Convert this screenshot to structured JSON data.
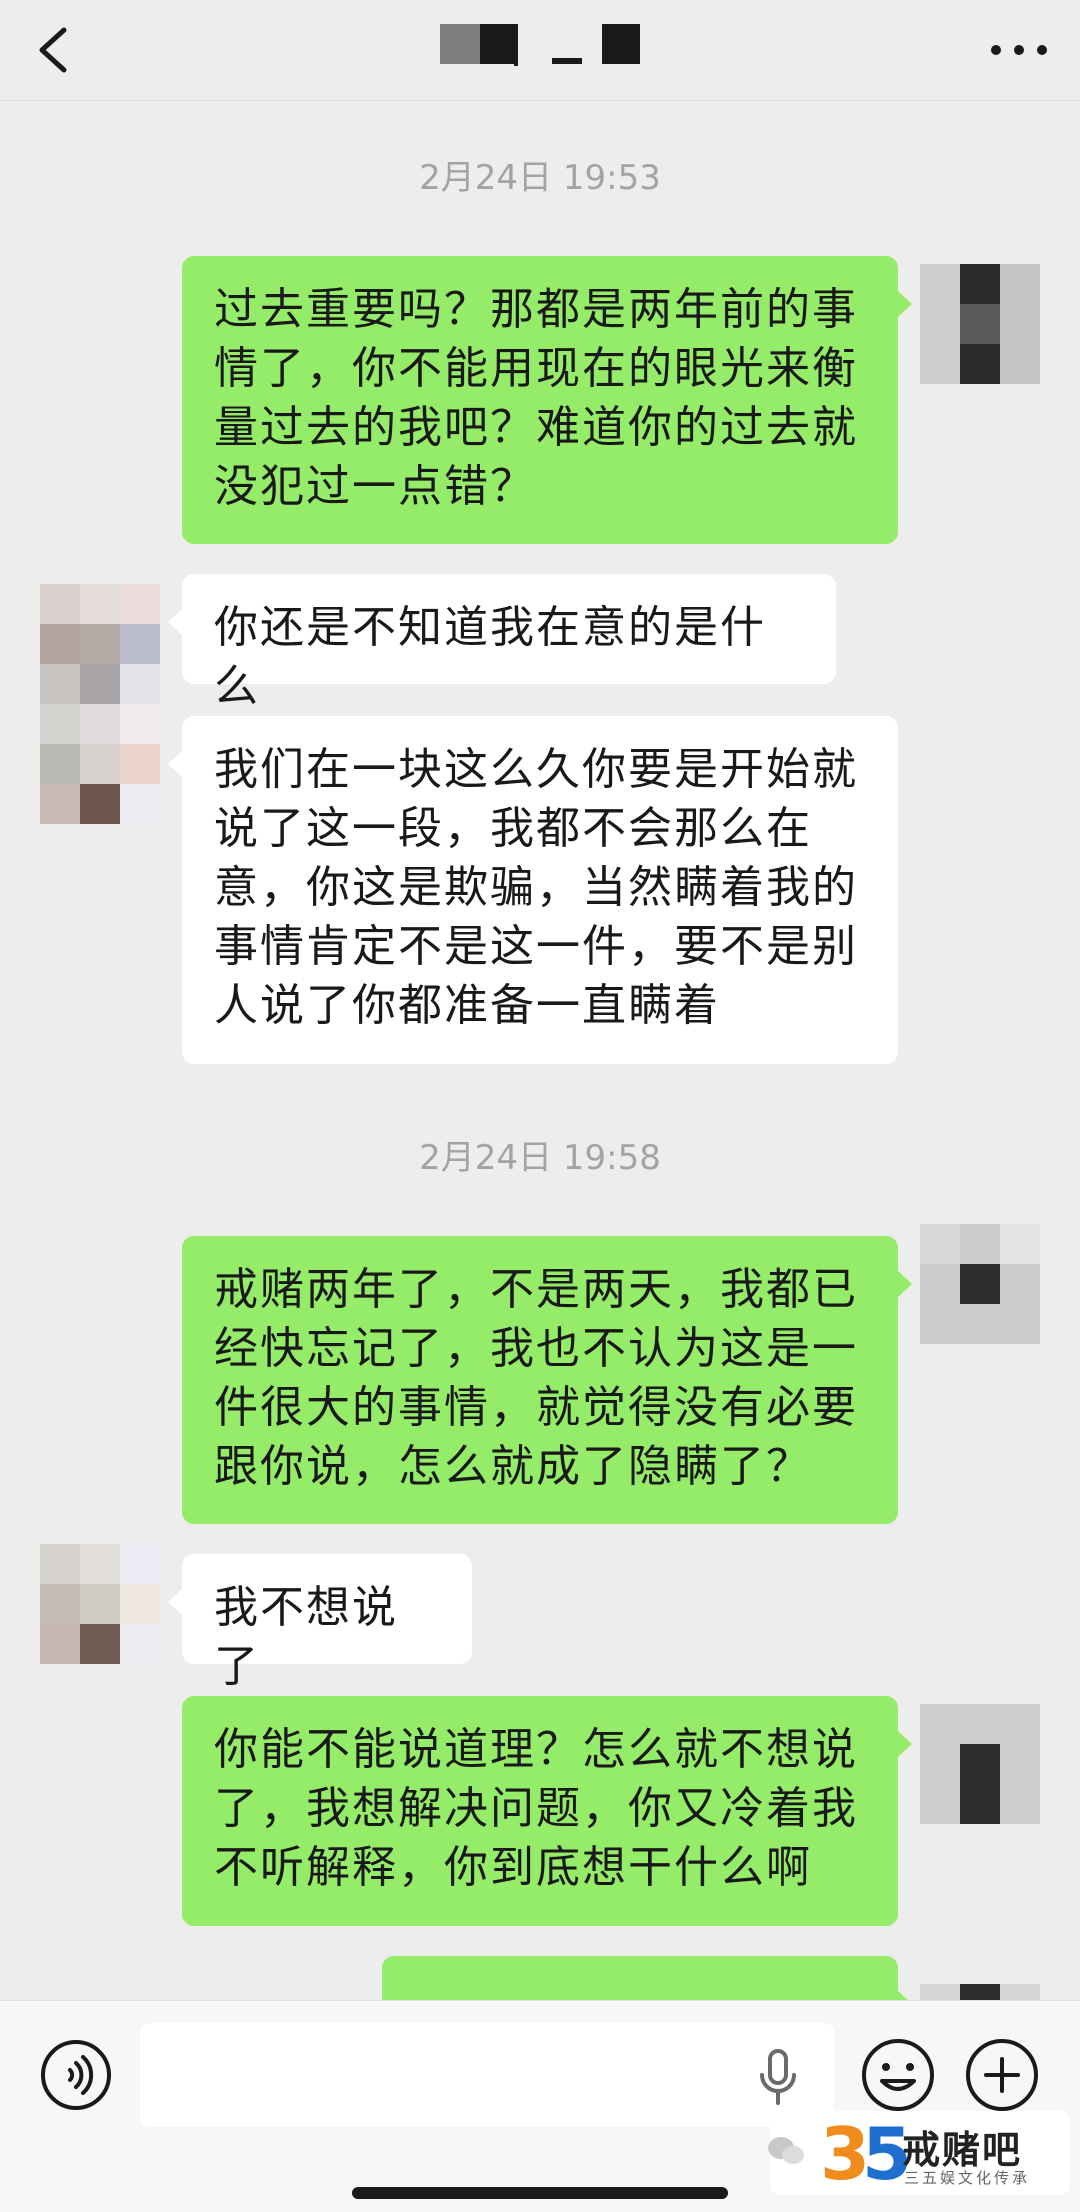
{
  "header": {
    "back_icon": "chevron-left-icon",
    "more_icon": "more-dots-icon",
    "title": "(name pixelated)"
  },
  "messages": [
    {
      "type": "timestamp",
      "text": "2月24日 19:53"
    },
    {
      "type": "outgoing",
      "text": "过去重要吗？那都是两年前的事\n情了，你不能用现在的眼光来衡\n量过去的我吧？难道你的过去就\n没犯过一点错？"
    },
    {
      "type": "incoming",
      "text": "你还是不知道我在意的是什么"
    },
    {
      "type": "incoming",
      "text": "我们在一块这么久你要是开始就\n说了这一段，我都不会那么在\n意，你这是欺骗，当然瞒着我的\n事情肯定不是这一件，要不是别\n人说了你都准备一直瞒着"
    },
    {
      "type": "timestamp",
      "text": "2月24日 19:58"
    },
    {
      "type": "outgoing",
      "text": "戒赌两年了，不是两天，我都已\n经快忘记了，我也不认为这是一\n件很大的事情，就觉得没有必要\n跟你说，怎么就成了隐瞒了？"
    },
    {
      "type": "incoming",
      "text": "我不想说了"
    },
    {
      "type": "outgoing",
      "text": "你能不能说道理？怎么就不想说\n了，我想解决问题，你又冷着我\n不听解释，你到底想干什么啊"
    }
  ],
  "input_bar": {
    "voice_icon": "voice-mode-icon",
    "input_value": "",
    "mic_icon": "microphone-icon",
    "emoji_icon": "emoji-icon",
    "plus_icon": "plus-circle-icon"
  },
  "watermark": {
    "logo": "35",
    "title": "戒赌吧",
    "subtitle": "三五娱文化传承"
  },
  "colors": {
    "background": "#ededed",
    "outgoing_bubble": "#95ec69",
    "incoming_bubble": "#ffffff",
    "timestamp": "#a3a3a3"
  }
}
